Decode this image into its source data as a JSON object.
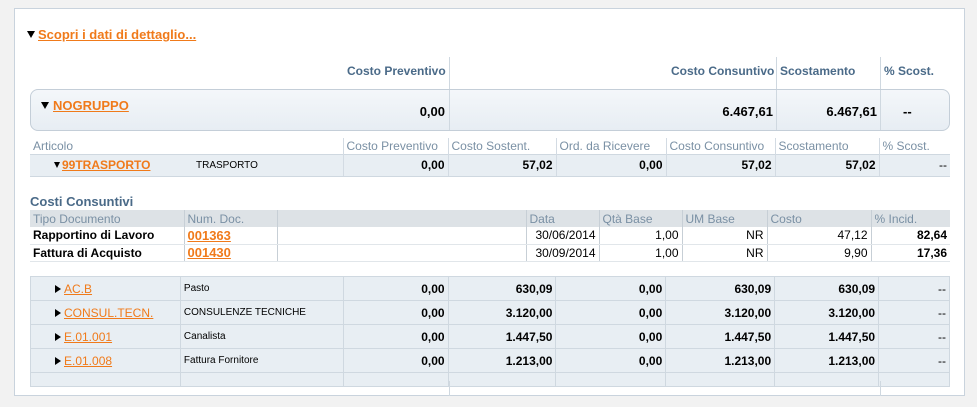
{
  "toggle_label": "Scopri i dati di dettaglio...",
  "top_headers": {
    "preventivo": "Costo Preventivo",
    "consuntivo": "Costo Consuntivo",
    "scostamento": "Scostamento",
    "perc": "% Scost."
  },
  "group": {
    "name": "NOGRUPPO",
    "preventivo": "0,00",
    "consuntivo": "6.467,61",
    "scostamento": "6.467,61",
    "perc": "--"
  },
  "art_headers": [
    "Articolo",
    "Costo Preventivo",
    "Costo Sostent.",
    "Ord. da Ricevere",
    "Costo Consuntivo",
    "Scostamento",
    "% Scost."
  ],
  "main_article": {
    "code": "99TRASPORTO",
    "desc": "TRASPORTO",
    "preventivo": "0,00",
    "sostenuto": "57,02",
    "ordini": "0,00",
    "consuntivo": "57,02",
    "scostamento": "57,02",
    "perc": "--"
  },
  "costs_title": "Costi Consuntivi",
  "doc_headers": [
    "Tipo Documento",
    "Num. Doc.",
    "",
    "Data",
    "Qtà Base",
    "UM Base",
    "Costo",
    "% Incid."
  ],
  "docs": [
    {
      "tipo": "Rapportino di Lavoro",
      "num": "001363",
      "data": "30/06/2014",
      "qta": "1,00",
      "um": "NR",
      "costo": "47,12",
      "incid": "82,64"
    },
    {
      "tipo": "Fattura di Acquisto",
      "num": "001430",
      "data": "30/09/2014",
      "qta": "1,00",
      "um": "NR",
      "costo": "9,90",
      "incid": "17,36"
    }
  ],
  "sub_articles": [
    {
      "code": "AC.B",
      "desc": "Pasto",
      "preventivo": "0,00",
      "sostenuto": "630,09",
      "ordini": "0,00",
      "consuntivo": "630,09",
      "scostamento": "630,09",
      "perc": "--"
    },
    {
      "code": "CONSUL.TECN.",
      "desc": "CONSULENZE TECNICHE",
      "preventivo": "0,00",
      "sostenuto": "3.120,00",
      "ordini": "0,00",
      "consuntivo": "3.120,00",
      "scostamento": "3.120,00",
      "perc": "--"
    },
    {
      "code": "E.01.001",
      "desc": "Canalista",
      "preventivo": "0,00",
      "sostenuto": "1.447,50",
      "ordini": "0,00",
      "consuntivo": "1.447,50",
      "scostamento": "1.447,50",
      "perc": "--"
    },
    {
      "code": "E.01.008",
      "desc": "Fattura Fornitore",
      "preventivo": "0,00",
      "sostenuto": "1.213,00",
      "ordini": "0,00",
      "consuntivo": "1.213,00",
      "scostamento": "1.213,00",
      "perc": "--"
    }
  ]
}
